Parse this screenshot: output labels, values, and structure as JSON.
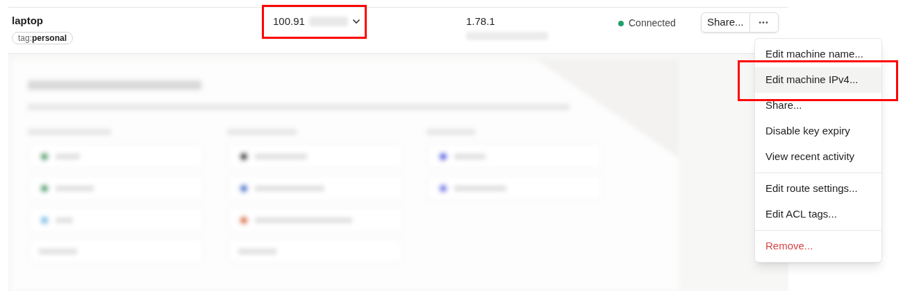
{
  "device": {
    "name": "laptop",
    "tag_key": "tag:",
    "tag_value": "personal",
    "ip": "100.91",
    "ip_annotated": true,
    "version": "1.78.1",
    "status": "Connected",
    "connected": true
  },
  "actions": {
    "share": "Share...",
    "more": "•••"
  },
  "menu": {
    "groups": [
      [
        {
          "label": "Edit machine name...",
          "selected": false,
          "annotated": false,
          "kind": "normal"
        },
        {
          "label": "Edit machine IPv4...",
          "selected": true,
          "annotated": true,
          "kind": "normal"
        },
        {
          "label": "Share...",
          "selected": false,
          "annotated": false,
          "kind": "normal"
        },
        {
          "label": "Disable key expiry",
          "selected": false,
          "annotated": false,
          "kind": "normal"
        },
        {
          "label": "View recent activity",
          "selected": false,
          "annotated": false,
          "kind": "normal"
        }
      ],
      [
        {
          "label": "Edit route settings...",
          "selected": false,
          "annotated": false,
          "kind": "normal"
        },
        {
          "label": "Edit ACL tags...",
          "selected": false,
          "annotated": false,
          "kind": "normal"
        }
      ],
      [
        {
          "label": "Remove...",
          "selected": false,
          "annotated": false,
          "kind": "danger"
        }
      ]
    ]
  }
}
